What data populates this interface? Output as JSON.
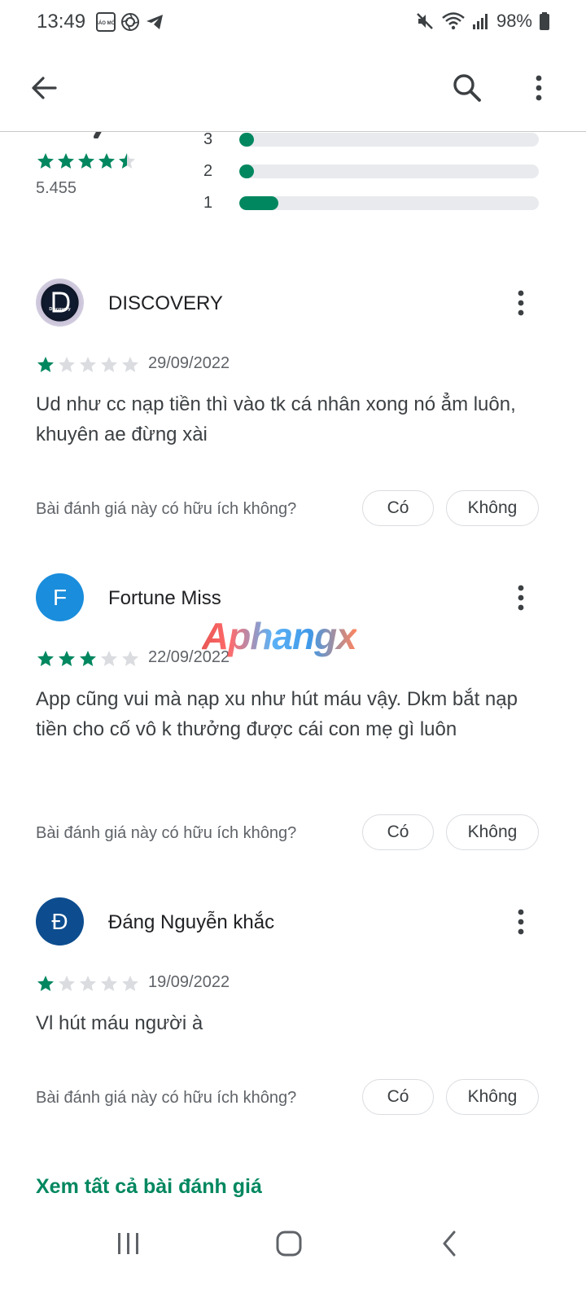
{
  "status_bar": {
    "time": "13:49",
    "battery": "98%",
    "notif_badge": "BÁO MỚI"
  },
  "rating_summary": {
    "count": "5.455",
    "stars": 4.5,
    "bars": [
      {
        "label": "3",
        "fill": 0.05
      },
      {
        "label": "2",
        "fill": 0.05
      },
      {
        "label": "1",
        "fill": 0.13
      }
    ]
  },
  "reviews": [
    {
      "name": "DISCOVERY",
      "avatar_initial": "",
      "avatar_text": "Discovery",
      "rating": 1,
      "date": "29/09/2022",
      "text": "Ud như cc nạp tiền thì vào tk cá nhân xong nó ẳm luôn, khuyên ae đừng xài"
    },
    {
      "name": "Fortune Miss",
      "avatar_initial": "F",
      "avatar_color": "#1a8ddc",
      "rating": 3,
      "date": "22/09/2022",
      "text": "App cũng vui mà nạp xu như hút máu vậy. Dkm bắt nạp tiền cho cố vô k thưởng được cái con mẹ gì luôn"
    },
    {
      "name": "Đáng Nguyễn khắc",
      "avatar_initial": "Đ",
      "avatar_color": "#0d4d8f",
      "rating": 1,
      "date": "19/09/2022",
      "text": "Vl hút máu người à"
    }
  ],
  "helpful": {
    "question": "Bài đánh giá này có hữu ích không?",
    "yes": "Có",
    "no": "Không"
  },
  "see_all": "Xem tất cả bài đánh giá",
  "watermark": "Aphangx",
  "colors": {
    "accent": "#01875f",
    "star_empty": "#dadce0"
  }
}
